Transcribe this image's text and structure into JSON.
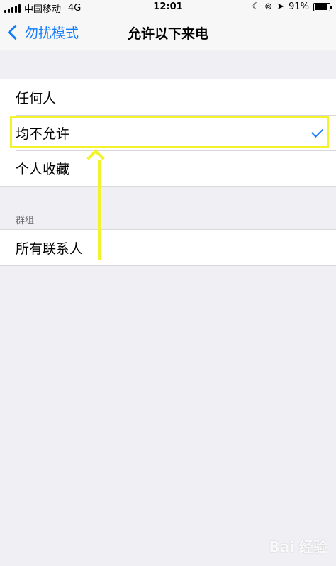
{
  "status_bar": {
    "carrier": "中国移动",
    "network": "4G",
    "time": "12:01",
    "battery": "91%",
    "battery_level": 0.91,
    "icons": [
      "moon-icon",
      "orientation-lock-icon",
      "location-icon"
    ]
  },
  "nav": {
    "back_label": "勿扰模式",
    "title": "允许以下来电"
  },
  "options": [
    {
      "label": "任何人",
      "selected": false
    },
    {
      "label": "均不允许",
      "selected": true
    },
    {
      "label": "个人收藏",
      "selected": false
    }
  ],
  "groups_section": {
    "header": "群组",
    "items": [
      {
        "label": "所有联系人"
      }
    ]
  },
  "watermark": "Bai 经验",
  "colors": {
    "accent": "#157efb",
    "annotation": "#f3f32c",
    "background": "#efeff4"
  }
}
